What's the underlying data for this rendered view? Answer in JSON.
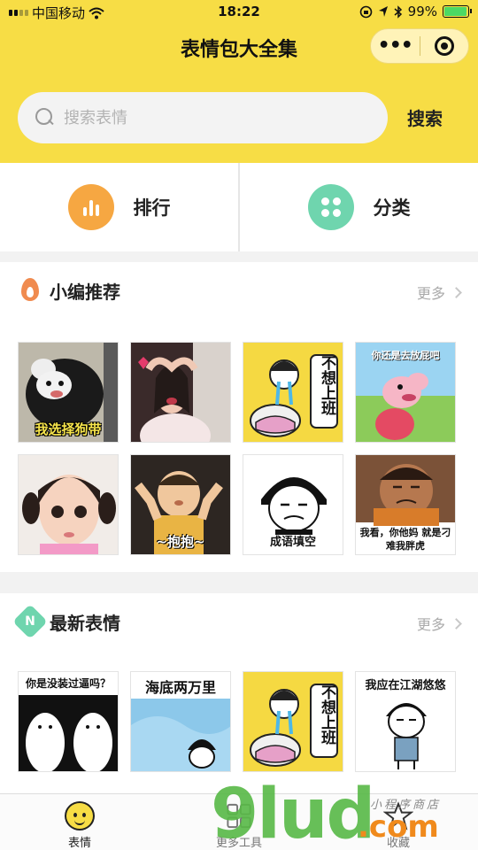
{
  "status_bar": {
    "carrier": "中国移动",
    "time": "18:22",
    "battery": "99%"
  },
  "app": {
    "title": "表情包大全集"
  },
  "search": {
    "placeholder": "搜索表情",
    "button": "搜索"
  },
  "quick_links": [
    {
      "label": "排行",
      "icon": "bar-chart-icon"
    },
    {
      "label": "分类",
      "icon": "grid-dots-icon"
    }
  ],
  "sections": [
    {
      "title": "小编推荐",
      "more": "更多",
      "icon": "flame-icon",
      "items": [
        {
          "caption": "我选择狗带",
          "desc": "panda bear meme"
        },
        {
          "caption": "",
          "desc": "girl heart gesture photo"
        },
        {
          "caption": "不想上班",
          "desc": "crying cartoon"
        },
        {
          "caption": "你还是去放屁吧",
          "desc": "peppa pig"
        },
        {
          "caption": "",
          "desc": "little girl photo"
        },
        {
          "caption": "~抱抱~",
          "desc": "baby photo"
        },
        {
          "caption": "成语填空",
          "desc": "rage face"
        },
        {
          "caption": "我看，你他妈 就是刁难我胖虎",
          "desc": "fat tiger"
        }
      ]
    },
    {
      "title": "最新表情",
      "more": "更多",
      "icon": "new-badge-icon",
      "badge": "N",
      "items": [
        {
          "caption": "你是没装过逼吗？",
          "desc": "two bears"
        },
        {
          "caption": "海底两万里",
          "desc": "mushroom head"
        },
        {
          "caption": "不想上班",
          "desc": "crying cartoon"
        },
        {
          "caption": "我应在江湖悠悠",
          "desc": "rage face with bag"
        }
      ]
    }
  ],
  "tabbar": [
    {
      "label": "表情",
      "active": true
    },
    {
      "label": "更多工具",
      "active": false
    },
    {
      "label": "收藏",
      "active": false
    }
  ],
  "watermark": {
    "main": "9lud",
    "suffix": ".com",
    "small": "小程序商店"
  },
  "colors": {
    "brand_yellow": "#f7dd45",
    "orange": "#f6a742",
    "green": "#6fd5ae"
  }
}
